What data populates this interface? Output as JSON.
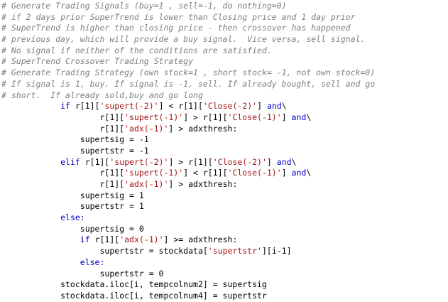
{
  "colors": {
    "comment": "#7f7f7f",
    "keyword": "#0000cc",
    "string": "#a31515",
    "text": "#000000",
    "background": "#ffffff"
  },
  "lines": [
    {
      "type": "comment",
      "text": "# Generate Trading Signals (buy=1 , sell=-1, do nothing=0)"
    },
    {
      "type": "comment",
      "text": "# if 2 days prior SuperTrend is lower than Closing price and 1 day prior"
    },
    {
      "type": "comment",
      "text": "# SuperTrend is higher than closing price - then crossover has happened"
    },
    {
      "type": "comment",
      "text": "# previous day, which will provide a buy signal.  Vice versa, sell signal."
    },
    {
      "type": "comment",
      "text": "# No signal if neither of the conditions are satisfied."
    },
    {
      "type": "comment",
      "text": "# SuperTrend Crossover Trading Strategy"
    },
    {
      "type": "comment",
      "text": "# Generate Trading Strategy (own stock=1 , short stock= -1, not own stock=0)"
    },
    {
      "type": "comment",
      "text": "# If signal is 1, buy. If signal is -1, sell. If already bought, sell and go"
    },
    {
      "type": "comment",
      "text": "# short.  If already sold,buy and go long"
    },
    {
      "type": "code",
      "tokens": [
        {
          "t": "            "
        },
        {
          "t": "if",
          "k": "kw"
        },
        {
          "t": " r[1]["
        },
        {
          "t": "'supert(-2)'",
          "k": "str"
        },
        {
          "t": "] < r[1]["
        },
        {
          "t": "'Close(-2)'",
          "k": "str"
        },
        {
          "t": "] "
        },
        {
          "t": "and",
          "k": "kw"
        },
        {
          "t": "\\"
        }
      ]
    },
    {
      "type": "code",
      "tokens": [
        {
          "t": "                    r[1]["
        },
        {
          "t": "'supert(-1)'",
          "k": "str"
        },
        {
          "t": "] > r[1]["
        },
        {
          "t": "'Close(-1)'",
          "k": "str"
        },
        {
          "t": "] "
        },
        {
          "t": "and",
          "k": "kw"
        },
        {
          "t": "\\"
        }
      ]
    },
    {
      "type": "code",
      "tokens": [
        {
          "t": "                    r[1]["
        },
        {
          "t": "'adx(-1)'",
          "k": "str"
        },
        {
          "t": "] > adxthresh:"
        }
      ]
    },
    {
      "type": "code",
      "tokens": [
        {
          "t": "                supertsig = -1"
        }
      ]
    },
    {
      "type": "code",
      "tokens": [
        {
          "t": "                supertstr = -1"
        }
      ]
    },
    {
      "type": "code",
      "tokens": [
        {
          "t": "            "
        },
        {
          "t": "elif",
          "k": "kw"
        },
        {
          "t": " r[1]["
        },
        {
          "t": "'supert(-2)'",
          "k": "str"
        },
        {
          "t": "] > r[1]["
        },
        {
          "t": "'Close(-2)'",
          "k": "str"
        },
        {
          "t": "] "
        },
        {
          "t": "and",
          "k": "kw"
        },
        {
          "t": "\\"
        }
      ]
    },
    {
      "type": "code",
      "tokens": [
        {
          "t": "                    r[1]["
        },
        {
          "t": "'supert(-1)'",
          "k": "str"
        },
        {
          "t": "] < r[1]["
        },
        {
          "t": "'Close(-1)'",
          "k": "str"
        },
        {
          "t": "] "
        },
        {
          "t": "and",
          "k": "kw"
        },
        {
          "t": "\\"
        }
      ]
    },
    {
      "type": "code",
      "tokens": [
        {
          "t": "                    r[1]["
        },
        {
          "t": "'adx(-1)'",
          "k": "str"
        },
        {
          "t": "] > adxthresh:"
        }
      ]
    },
    {
      "type": "code",
      "tokens": [
        {
          "t": "                supertsig = 1"
        }
      ]
    },
    {
      "type": "code",
      "tokens": [
        {
          "t": "                supertstr = 1"
        }
      ]
    },
    {
      "type": "code",
      "tokens": [
        {
          "t": "            "
        },
        {
          "t": "else:",
          "k": "kw"
        }
      ]
    },
    {
      "type": "code",
      "tokens": [
        {
          "t": "                supertsig = 0"
        }
      ]
    },
    {
      "type": "code",
      "tokens": [
        {
          "t": "                "
        },
        {
          "t": "if",
          "k": "kw"
        },
        {
          "t": " r[1]["
        },
        {
          "t": "'adx(-1)'",
          "k": "str"
        },
        {
          "t": "] >= adxthresh:"
        }
      ]
    },
    {
      "type": "code",
      "tokens": [
        {
          "t": "                    supertstr = stockdata["
        },
        {
          "t": "'supertstr'",
          "k": "str"
        },
        {
          "t": "][i-1]"
        }
      ]
    },
    {
      "type": "code",
      "tokens": [
        {
          "t": "                "
        },
        {
          "t": "else:",
          "k": "kw"
        }
      ]
    },
    {
      "type": "code",
      "tokens": [
        {
          "t": "                    supertstr = 0"
        }
      ]
    },
    {
      "type": "code",
      "tokens": [
        {
          "t": "            stockdata.iloc[i, tempcolnum2] = supertsig"
        }
      ]
    },
    {
      "type": "code",
      "tokens": [
        {
          "t": "            stockdata.iloc[i, tempcolnum4] = supertstr"
        }
      ]
    }
  ]
}
